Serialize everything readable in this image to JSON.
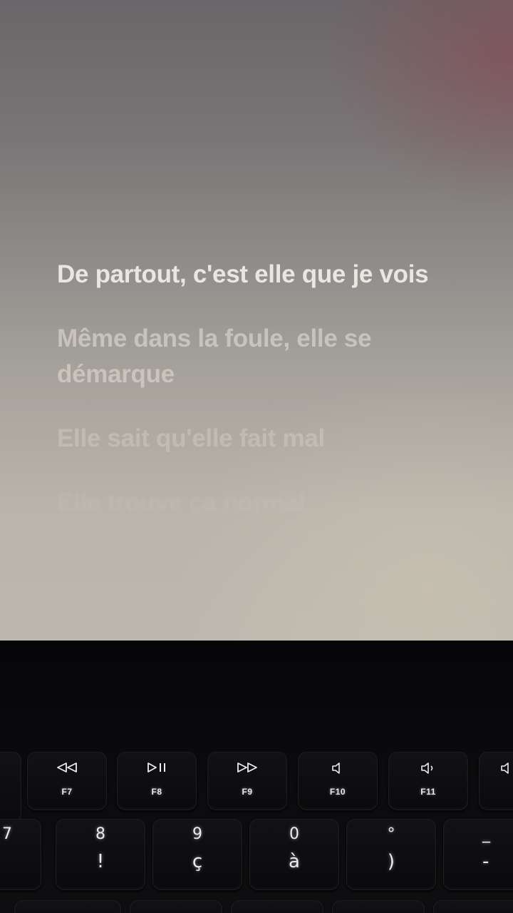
{
  "lyrics": {
    "active": "De partout, c'est elle que je vois",
    "next1": "Même dans la foule, elle se démarque",
    "next2": "Elle sait qu'elle fait mal",
    "next3": "Elle trouve ça normal"
  },
  "function_keys": [
    {
      "label": "F7",
      "icon": "rewind-icon"
    },
    {
      "label": "F8",
      "icon": "play-pause-icon"
    },
    {
      "label": "F9",
      "icon": "fast-forward-icon"
    },
    {
      "label": "F10",
      "icon": "mute-icon"
    },
    {
      "label": "F11",
      "icon": "volume-down-icon"
    },
    {
      "label": "",
      "icon": "volume-up-icon"
    }
  ],
  "number_keys": [
    {
      "top": "7",
      "bottom": ""
    },
    {
      "top": "8",
      "bottom": "!"
    },
    {
      "top": "9",
      "bottom": "ç"
    },
    {
      "top": "0",
      "bottom": "à"
    },
    {
      "top": "°",
      "bottom": ")"
    },
    {
      "top": "_",
      "bottom": "-"
    }
  ]
}
